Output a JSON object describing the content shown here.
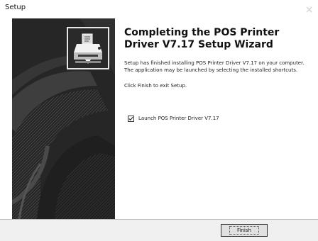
{
  "window": {
    "title": "Setup",
    "close_icon": "close-icon"
  },
  "side_panel": {
    "logo_icon": "printer-logo-icon"
  },
  "content": {
    "heading": "Completing the POS Printer Driver V7.17 Setup Wizard",
    "description": "Setup has finished installing POS Printer Driver V7.17 on your computer. The application may be launched by selecting the installed shortcuts.",
    "hint": "Click Finish to exit Setup.",
    "launch_checkbox": {
      "label": "Launch POS Printer Driver V7.17",
      "checked": true
    }
  },
  "footer": {
    "finish_label": "Finish"
  }
}
